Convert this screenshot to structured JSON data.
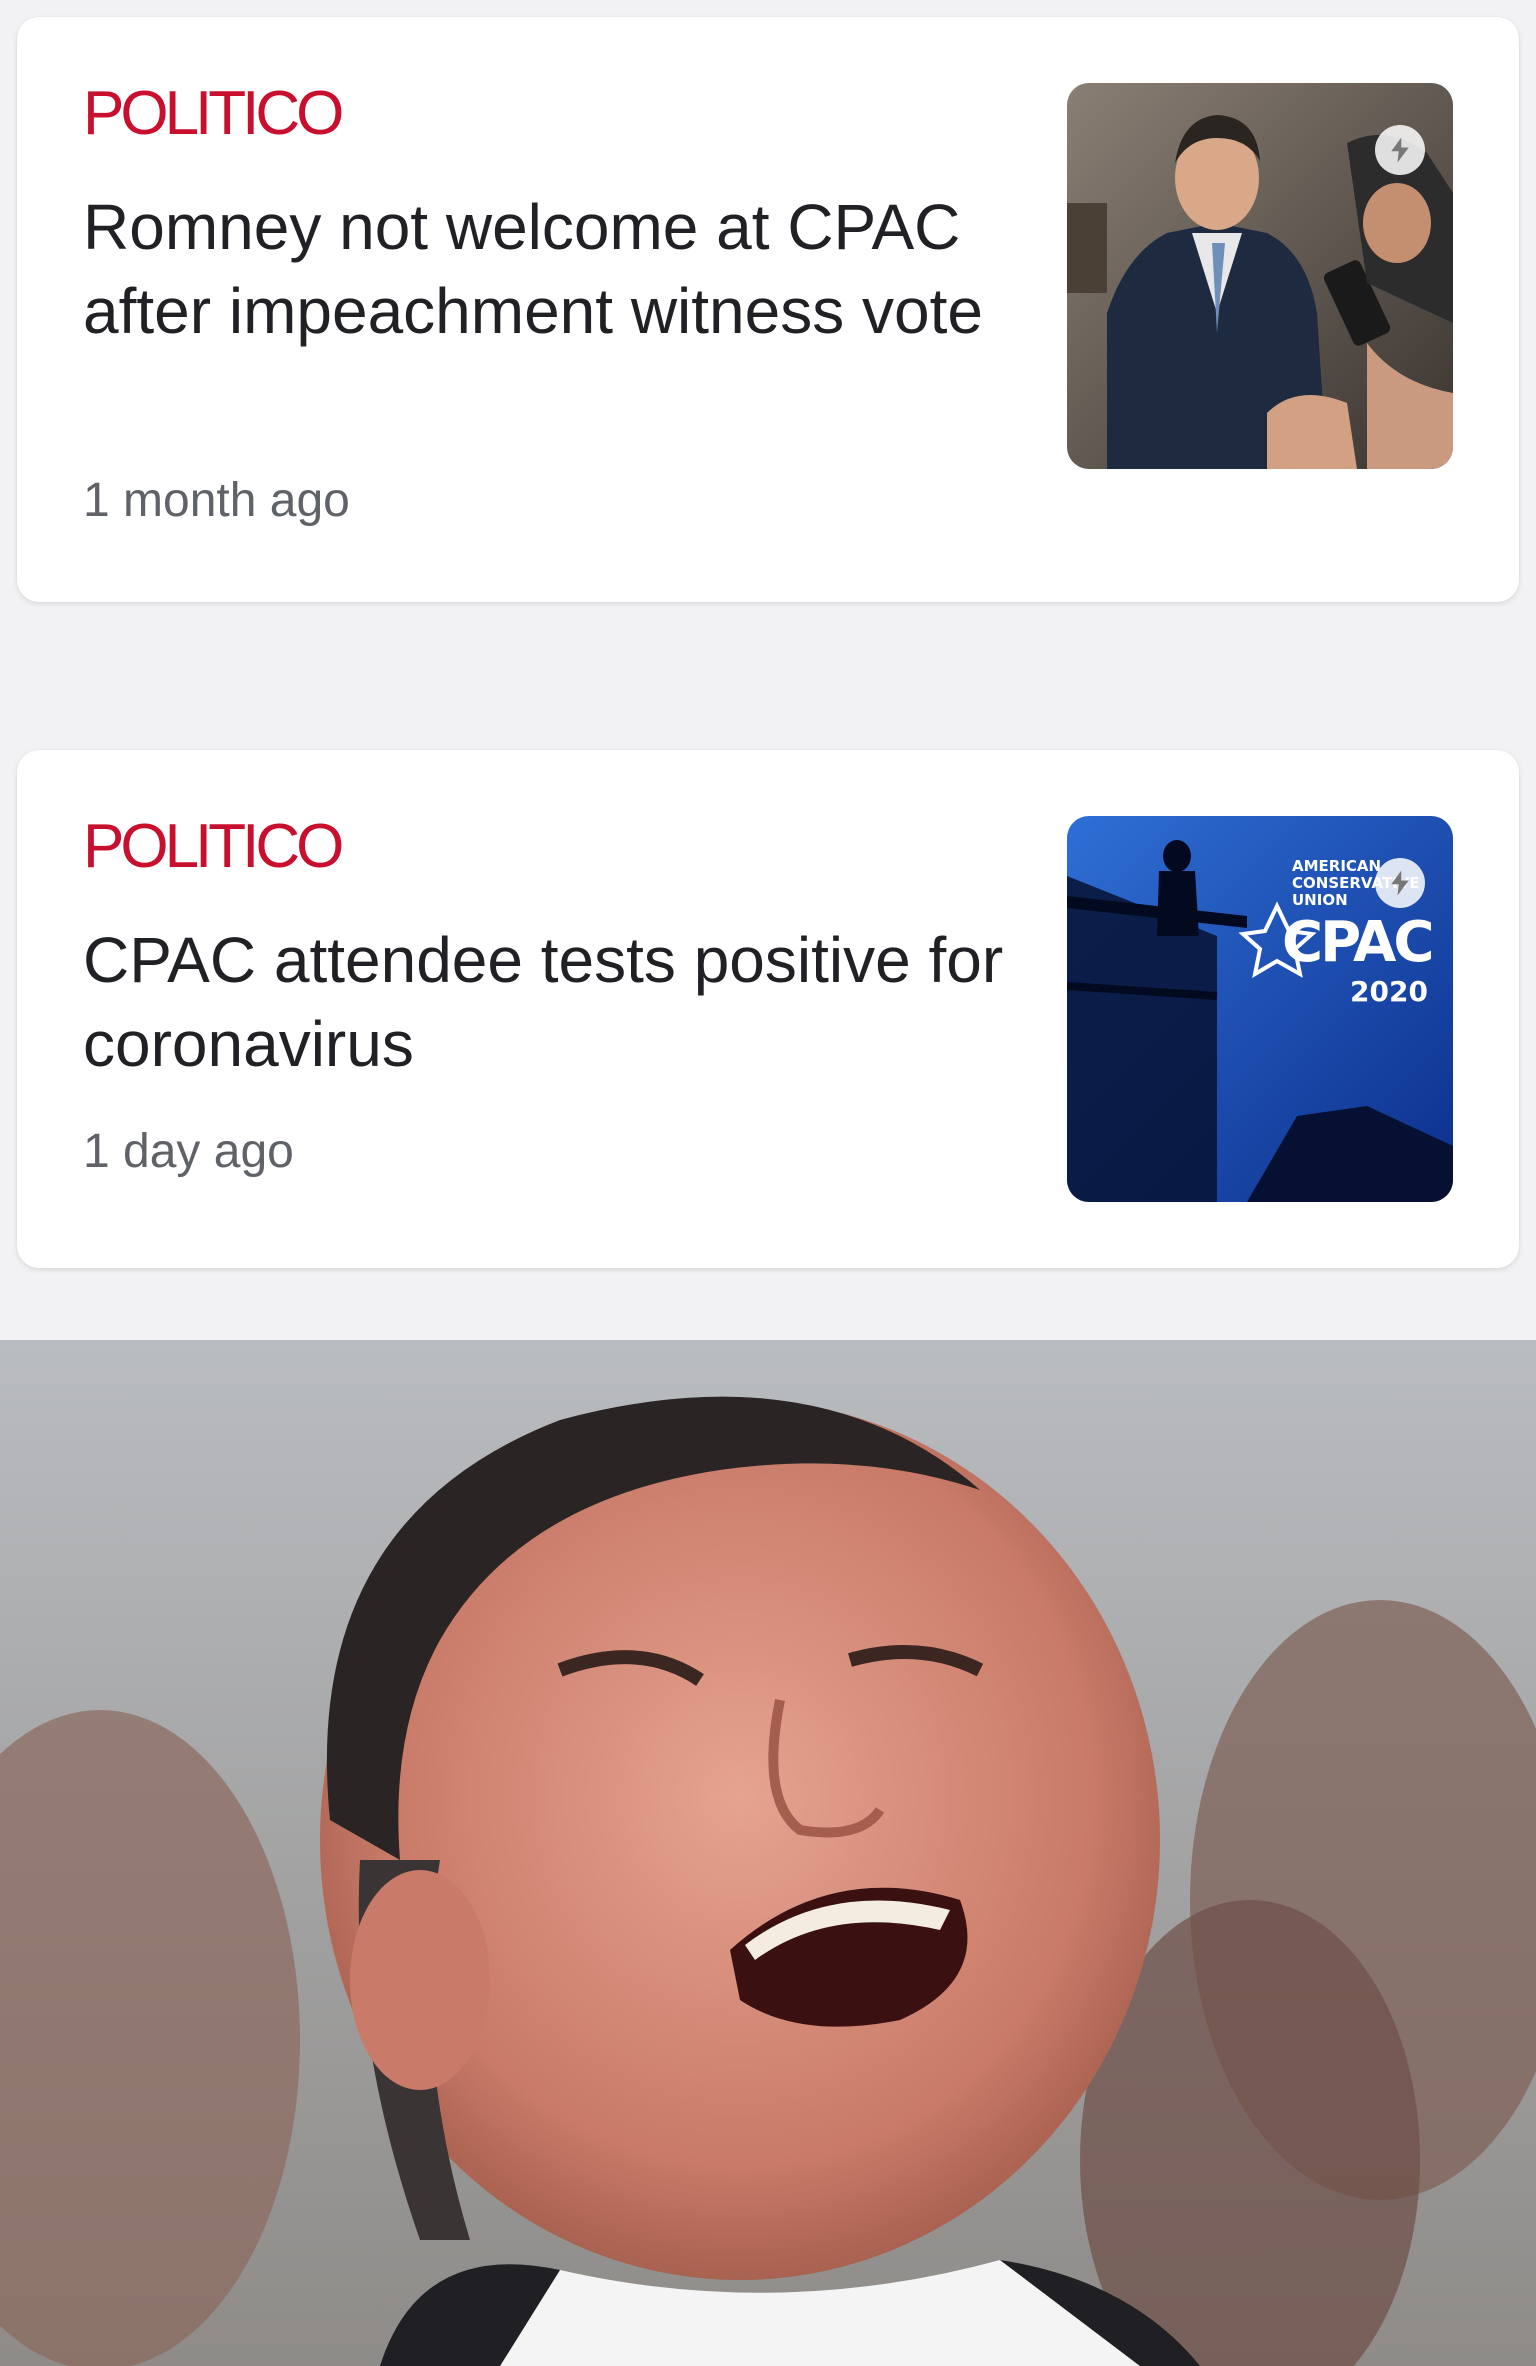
{
  "colors": {
    "brand": "#c8102e",
    "headline": "#202124",
    "meta": "#5f6368",
    "background": "#f2f2f4"
  },
  "cards": [
    {
      "source": "POLITICO",
      "headline": "Romney not welcome at CPAC after impeachment witness vote",
      "timestamp": "1 month ago",
      "thumbnail_icon": "amp-lightning-icon"
    },
    {
      "source": "POLITICO",
      "headline": "CPAC attendee tests positive for coronavirus",
      "timestamp": "1 day ago",
      "thumbnail_icon": "amp-lightning-icon"
    }
  ],
  "thumbnail_2_text": {
    "org_line_1": "AMERICAN",
    "org_line_2": "CONSERVATIVE",
    "org_line_3": "UNION",
    "logo": "CPAC",
    "year": "2020"
  }
}
